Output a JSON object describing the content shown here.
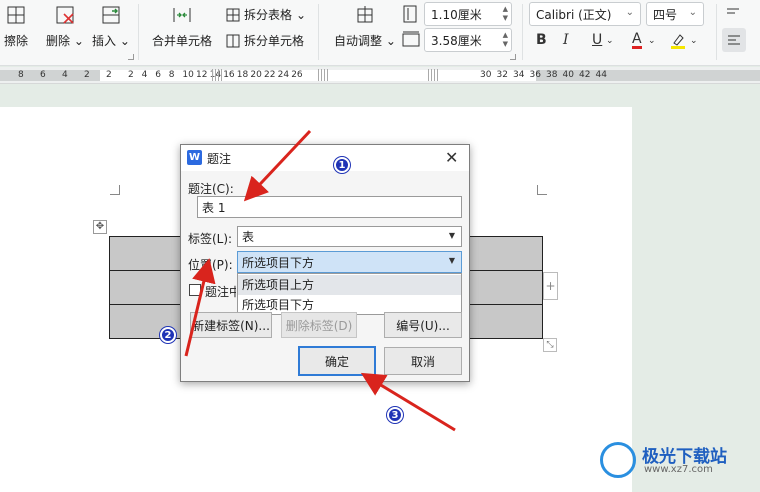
{
  "ribbon": {
    "erase": "擦除",
    "delete": "删除",
    "insert": "插入",
    "merge_cells": "合并单元格",
    "split_table": "拆分表格",
    "split_cells": "拆分单元格",
    "auto_fit": "自动调整",
    "row_height": "1.10厘米",
    "col_width": "3.58厘米",
    "font_name": "Calibri (正文)",
    "font_size": "四号",
    "bold": "B",
    "italic": "I",
    "underline": "U",
    "font_color": "A"
  },
  "ruler": {
    "left_labels": [
      "8",
      "6",
      "4",
      "2",
      "2"
    ],
    "mid_labels": [
      "2",
      "4",
      "6",
      "8",
      "10",
      "12",
      "14",
      "16",
      "18",
      "20",
      "22",
      "24",
      "26"
    ],
    "right_labels": [
      "30",
      "32",
      "34",
      "36",
      "38",
      "40",
      "42",
      "44"
    ]
  },
  "dialog": {
    "title": "题注",
    "caption_label": "题注(C):",
    "caption_value": "表 1",
    "tag_label": "标签(L):",
    "tag_value": "表",
    "position_label": "位置(P):",
    "position_value": "所选项目下方",
    "options": [
      "所选项目上方",
      "所选项目下方"
    ],
    "exclude_label": "题注中",
    "new_tag": "新建标签(N)...",
    "delete_tag": "删除标签(D)",
    "numbering": "编号(U)...",
    "ok": "确定",
    "cancel": "取消"
  },
  "annotations": {
    "step1": "1",
    "step2": "2",
    "step3": "3",
    "arrow_color": "#d9241d",
    "badge_color": "#1f33b6"
  },
  "watermark": {
    "title": "极光下载站",
    "url": "www.xz7.com"
  }
}
